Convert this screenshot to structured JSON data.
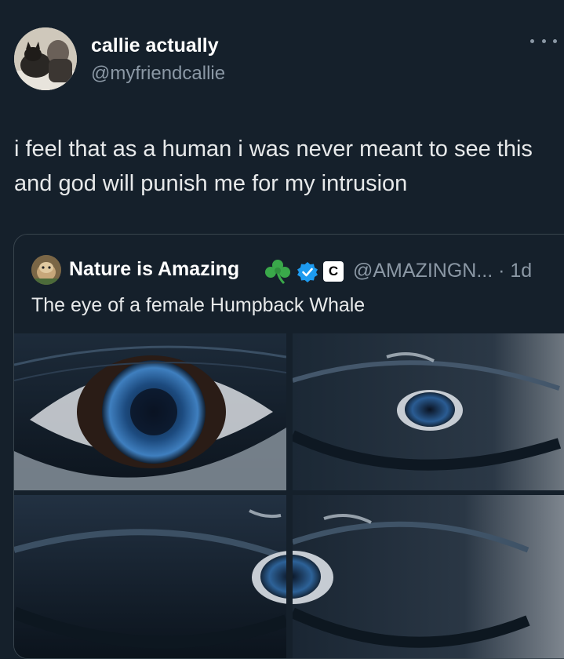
{
  "tweet": {
    "display_name": "callie actually",
    "handle": "@myfriendcallie",
    "avatar_icon": "profile-photo-avatar",
    "more_icon": "more-options-icon",
    "text": "i feel that as a human i was never meant to see this and god will punish me for my intrusion"
  },
  "quote": {
    "display_name": "Nature is Amazing",
    "emoji_icon": "shamrock-icon",
    "verified_icon": "verified-badge-icon",
    "affiliate_badge": "C",
    "handle_time": "@AMAZINGN... · 1d",
    "text": "The eye of a female Humpback Whale",
    "photos": [
      {
        "name": "whale-eye-photo-1"
      },
      {
        "name": "whale-eye-photo-2"
      },
      {
        "name": "whale-eye-photo-3"
      },
      {
        "name": "whale-eye-photo-4"
      }
    ]
  },
  "colors": {
    "background": "#15202b",
    "text_primary": "#e7e9ea",
    "text_secondary": "#8b98a5",
    "verified": "#1d9bf0",
    "card_border": "#38444d"
  }
}
